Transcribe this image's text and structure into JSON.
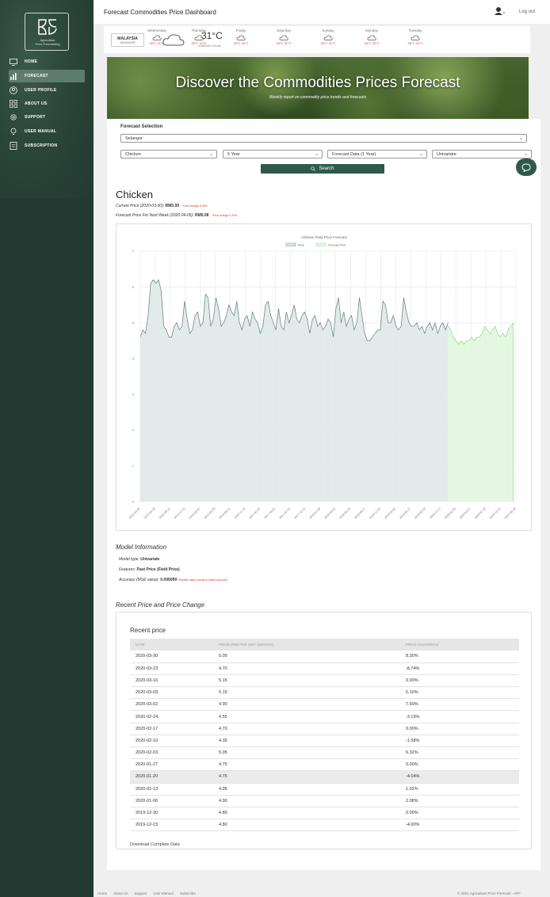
{
  "app": {
    "title": "Forecast Commodities Price Dashboard",
    "logout": "Log out"
  },
  "logo": {
    "caption_1": "Agriculture",
    "caption_2": "Price Forecasting"
  },
  "sidebar": {
    "items": [
      {
        "label": "HOME"
      },
      {
        "label": "FORECAST"
      },
      {
        "label": "USER PROFILE"
      },
      {
        "label": "ABOUT US"
      },
      {
        "label": "SUPPORT"
      },
      {
        "label": "USER MANUAL"
      },
      {
        "label": "SUBSCRIPTION"
      }
    ]
  },
  "weather": {
    "location": "MALAYSIA",
    "location_sub": "SELANGOR",
    "temperature": "31°C",
    "condition": "scattered clouds",
    "days": [
      {
        "name": "Wednesday",
        "temps": "26°C  31°C"
      },
      {
        "name": "Thursday",
        "temps": "26°C  32°C"
      },
      {
        "name": "Friday",
        "temps": "26°C  32°C"
      },
      {
        "name": "Saturday",
        "temps": "26°C  31°C"
      },
      {
        "name": "Sunday",
        "temps": "26°C  31°C"
      },
      {
        "name": "Monday",
        "temps": "26°C  32°C"
      },
      {
        "name": "Tuesday",
        "temps": "26°C  32°C"
      }
    ]
  },
  "hero": {
    "title": "Discover the Commodities Prices Forecast",
    "subtitle": "Weekly report on commodity price trends and forecasts"
  },
  "forecast": {
    "section_label": "Forecast Selection",
    "state": "Selangor",
    "commodity": "Chicken",
    "period": "5 Year",
    "forecast_data": "Forecast Data (1 Year)",
    "model": "Univariate",
    "search_label": "Search"
  },
  "result": {
    "commodity": "Chicken",
    "current_label": "Current Price (2020-03-30):",
    "current_value": "RM5.09",
    "current_change": "Price change 8.30%",
    "next_label": "Forecast Price For Next Week (2020-04-06):",
    "next_value": "RM5.08",
    "next_change": "Price change 0.20%"
  },
  "chart_data": {
    "type": "area",
    "title": "Chicken Field Price Forecast",
    "legend": [
      "Price",
      "Forecast Price"
    ],
    "legend_position": "top",
    "grid": true,
    "ylim": [
      0,
      7
    ],
    "y_ticks": [
      "0",
      "1",
      "2",
      "3",
      "4",
      "5",
      "6",
      "7"
    ],
    "x_ticks": [
      "2015-04-06",
      "2015-06-29",
      "2015-09-21",
      "2015-12-14",
      "2016-03-07",
      "2016-05-30",
      "2016-08-22",
      "2016-11-14",
      "2017-02-06",
      "2017-05-01",
      "2017-07-24",
      "2017-10-16",
      "2018-01-08",
      "2018-04-02",
      "2018-06-25",
      "2018-09-17",
      "2018-12-10",
      "2019-03-04",
      "2019-05-27",
      "2019-08-19",
      "2019-11-11",
      "2020-02-03",
      "2020-04-27",
      "2020-07-20",
      "2020-10-12",
      "2021-03-29"
    ],
    "series": [
      {
        "name": "Price",
        "values": [
          4.6,
          4.8,
          4.7,
          5.2,
          6.1,
          6.2,
          6.1,
          6.2,
          5.9,
          4.9,
          4.8,
          4.6,
          4.6,
          4.9,
          5.0,
          4.8,
          4.9,
          5.6,
          5.1,
          4.7,
          4.8,
          5.2,
          5.3,
          4.9,
          5.0,
          5.8,
          5.7,
          4.9,
          5.1,
          5.7,
          5.4,
          4.9,
          5.0,
          5.2,
          5.5,
          5.3,
          5.2,
          5.6,
          5.0,
          4.8,
          5.1,
          5.2,
          4.9,
          5.3,
          5.1,
          5.0,
          4.7,
          4.9,
          5.5,
          5.6,
          5.2,
          5.0,
          4.8,
          5.4,
          4.9,
          4.8,
          5.3,
          5.0,
          5.2,
          5.5,
          5.1,
          5.0,
          5.2,
          5.3,
          5.1,
          4.7,
          5.1,
          5.2,
          4.9,
          5.0,
          4.8,
          4.9,
          5.1,
          5.0,
          4.6,
          5.4,
          5.7,
          5.0,
          5.3,
          4.9,
          5.1,
          5.2,
          4.8,
          5.0,
          5.7,
          5.2,
          4.7,
          4.5,
          4.5,
          4.6,
          4.7,
          4.8,
          4.8,
          5.6,
          5.5,
          5.0,
          5.0,
          5.2,
          4.9,
          4.8,
          4.9,
          5.7,
          5.3,
          5.0,
          4.9,
          4.9,
          5.0,
          4.8,
          4.9,
          4.7,
          4.9,
          5.0,
          4.8,
          5.0,
          4.7,
          4.9,
          5.0,
          4.8,
          5.0
        ]
      },
      {
        "name": "Forecast Price",
        "values": [
          4.9,
          4.8,
          4.6,
          4.5,
          4.4,
          4.5,
          4.4,
          4.5,
          4.5,
          4.6,
          4.5,
          4.6,
          4.6,
          4.7,
          4.9,
          4.8,
          4.7,
          4.8,
          4.9,
          4.7,
          4.6,
          4.7,
          4.6,
          4.8,
          4.9,
          5.0
        ]
      }
    ]
  },
  "model_info": {
    "title": "Model Information",
    "type_label": "Model type:",
    "type_value": "Univariate",
    "features_label": "Features:",
    "features_value": "Past Price (Field Price)",
    "accuracy_label": "Accuracy (MSE value):",
    "accuracy_value": "0.095099",
    "accuracy_note": "*Smaller value results in better accuracy"
  },
  "recent": {
    "section_title": "Recent Price and Price Change",
    "title": "Recent price",
    "columns": [
      "DATE",
      "PRICE (RM) PER UNIT (WEIGHT)",
      "PRICE CHANGE(%)"
    ],
    "rows": [
      [
        "2020-03-30",
        "5.09",
        "8.30%"
      ],
      [
        "2020-03-23",
        "4.70",
        "-8.74%"
      ],
      [
        "2020-03-16",
        "5.15",
        "0.00%"
      ],
      [
        "2020-03-09",
        "5.15",
        "5.10%"
      ],
      [
        "2020-03-02",
        "4.90",
        "7.69%"
      ],
      [
        "2020-02-24",
        "4.55",
        "-3.19%"
      ],
      [
        "2020-02-17",
        "4.70",
        "0.00%"
      ],
      [
        "2020-02-10",
        "4.35",
        "-1.58%"
      ],
      [
        "2020-02-03",
        "5.05",
        "6.32%"
      ],
      [
        "2020-01-27",
        "4.75",
        "0.00%"
      ],
      [
        "2020-01-20",
        "4.75",
        "-4.04%"
      ],
      [
        "2020-01-13",
        "4.95",
        "1.02%"
      ],
      [
        "2020-01-06",
        "4.90",
        "2.08%"
      ],
      [
        "2019-12-30",
        "4.80",
        "0.00%"
      ],
      [
        "2019-12-23",
        "4.80",
        "-4.00%"
      ]
    ],
    "download": "Download Complete Data"
  },
  "footer": {
    "links": [
      "Home",
      "About Us",
      "Support",
      "User Manual",
      "Subscribe"
    ],
    "copyright": "© 2021 Agriculture Price Forecast - APF"
  }
}
